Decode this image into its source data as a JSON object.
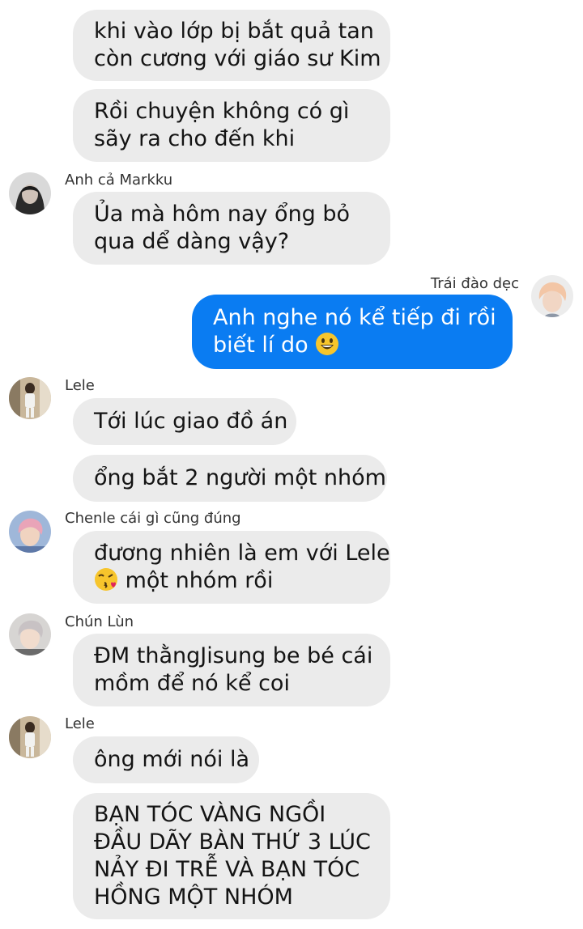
{
  "messages": [
    {
      "sender": "",
      "lines": [
        "khi vào lớp bị bắt quả tan",
        "còn cương với giáo sư Kim"
      ]
    },
    {
      "sender": "",
      "lines": [
        "Rồi chuyện không có gì",
        "sãy ra cho đến khi"
      ]
    },
    {
      "sender": "Anh cả Markku",
      "lines": [
        "Ủa mà hôm nay ổng bỏ",
        "qua dể dàng vậy?"
      ]
    },
    {
      "sender": "Trái đào dẹc",
      "lines": [
        "Anh nghe nó kể tiếp đi rồi",
        "biết lí do"
      ]
    },
    {
      "sender": "Lele",
      "lines": [
        "Tới lúc giao đồ án"
      ]
    },
    {
      "sender": "",
      "lines": [
        "ổng bắt 2 người một nhóm"
      ]
    },
    {
      "sender": "Chenle cái gì cũng đúng",
      "lines": [
        "đương nhiên là em với Lele",
        "một nhóm rồi"
      ]
    },
    {
      "sender": "Chún Lùn",
      "lines": [
        "ĐM thằngJisung be bé cái",
        "mồm để nó kể coi"
      ]
    },
    {
      "sender": "Lele",
      "lines": [
        "ông mới nói là"
      ]
    },
    {
      "sender": "",
      "lines": [
        "BẠN TÓC VÀNG NGỒI",
        "ĐẦU DÃY BÀN THỨ 3 LÚC",
        "NẢY ĐI TRỄ VÀ BẠN TÓC",
        "HỒNG MỘT NHÓM"
      ]
    }
  ],
  "icons": {
    "grin": "grinning-face-emoji",
    "kiss": "face-blowing-kiss-emoji"
  },
  "colors": {
    "incoming_bubble": "#ebebeb",
    "outgoing_bubble": "#0a7cf2",
    "background": "#ffffff"
  }
}
